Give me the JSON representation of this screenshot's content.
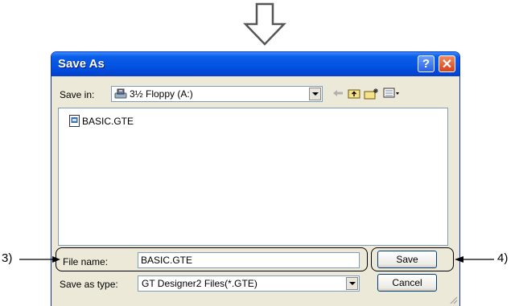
{
  "dialog": {
    "title": "Save As",
    "help_label": "?",
    "close_label": "✕"
  },
  "save_in": {
    "label": "Save in:",
    "value": "3½ Floppy (A:)"
  },
  "files": [
    {
      "name": "BASIC.GTE"
    }
  ],
  "file_name": {
    "label": "File name:",
    "value": "BASIC.GTE"
  },
  "save_as_type": {
    "label": "Save as type:",
    "value": "GT Designer2 Files(*.GTE)"
  },
  "buttons": {
    "save": "Save",
    "cancel": "Cancel"
  },
  "callouts": {
    "filename_ref": "3)",
    "save_ref": "4)"
  },
  "colors": {
    "titlebar": "#0554e3",
    "dialog_bg": "#ece9d8",
    "close_button": "#d2441b"
  },
  "icons": [
    "down-arrow-icon",
    "floppy-drive-icon",
    "back-icon",
    "up-folder-icon",
    "new-folder-icon",
    "view-menu-icon",
    "file-icon",
    "resize-grip-icon"
  ]
}
